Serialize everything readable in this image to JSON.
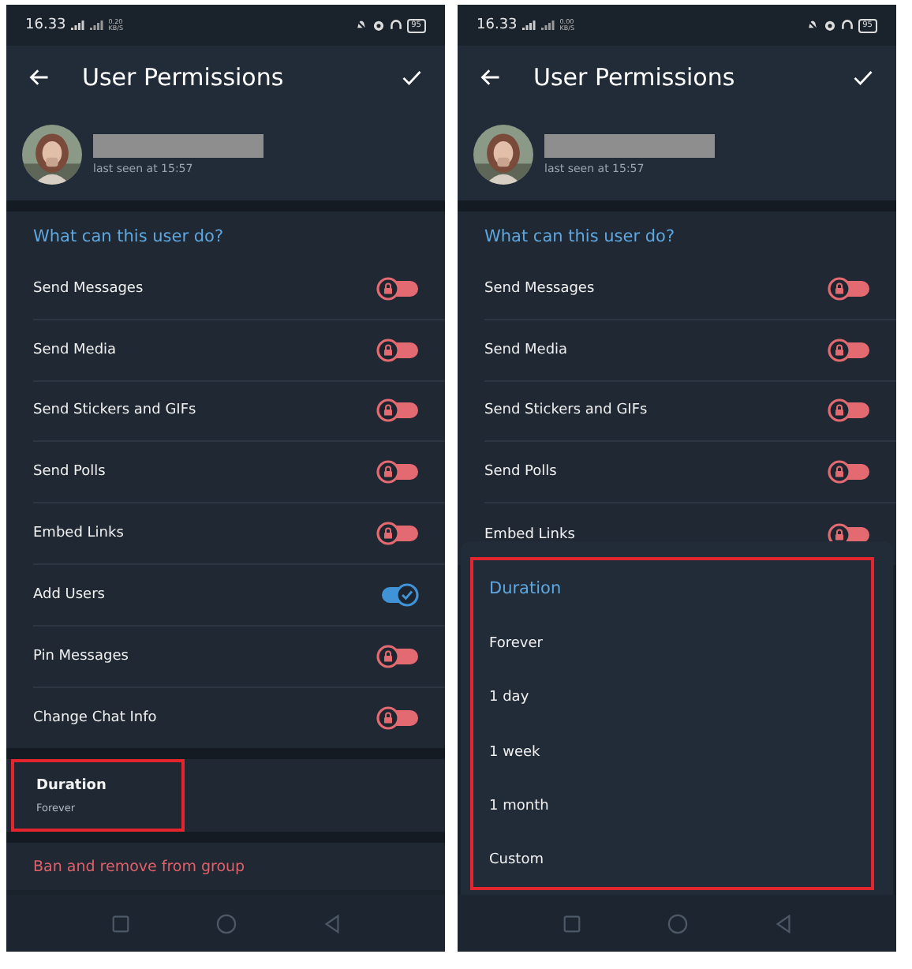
{
  "phones": [
    {
      "status_bar": {
        "time": "16.33",
        "net_speed": "0.20 KB/S",
        "battery": "95"
      },
      "header": {
        "title": "User Permissions"
      },
      "profile": {
        "status": "last seen at 15:57"
      },
      "section": {
        "title": "What can this user do?",
        "permissions": [
          {
            "label": "Send Messages",
            "on": false,
            "locked": true
          },
          {
            "label": "Send Media",
            "on": false,
            "locked": true
          },
          {
            "label": "Send Stickers and GIFs",
            "on": false,
            "locked": true
          },
          {
            "label": "Send Polls",
            "on": false,
            "locked": true
          },
          {
            "label": "Embed Links",
            "on": false,
            "locked": true
          },
          {
            "label": "Add Users",
            "on": true,
            "locked": false
          },
          {
            "label": "Pin Messages",
            "on": false,
            "locked": true
          },
          {
            "label": "Change Chat Info",
            "on": false,
            "locked": true
          }
        ]
      },
      "duration": {
        "label": "Duration",
        "value": "Forever",
        "highlighted": true
      },
      "ban_action": "Ban and remove from group"
    },
    {
      "status_bar": {
        "time": "16.33",
        "net_speed": "0.00 KB/S",
        "battery": "95"
      },
      "header": {
        "title": "User Permissions"
      },
      "profile": {
        "status": "last seen at 15:57"
      },
      "section": {
        "title": "What can this user do?",
        "permissions": [
          {
            "label": "Send Messages",
            "on": false,
            "locked": true
          },
          {
            "label": "Send Media",
            "on": false,
            "locked": true
          },
          {
            "label": "Send Stickers and GIFs",
            "on": false,
            "locked": true
          },
          {
            "label": "Send Polls",
            "on": false,
            "locked": true
          },
          {
            "label": "Embed Links",
            "on": false,
            "locked": true
          }
        ]
      },
      "sheet": {
        "title": "Duration",
        "highlighted": true,
        "options": [
          "Forever",
          "1 day",
          "1 week",
          "1 month",
          "Custom"
        ]
      }
    }
  ]
}
